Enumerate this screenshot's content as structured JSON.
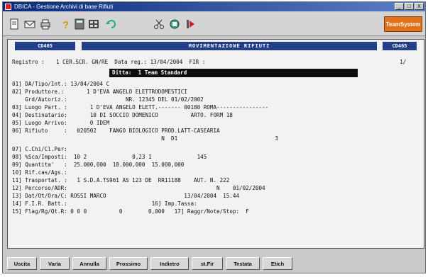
{
  "titlebar": {
    "title": "DBICA - Gestione Archivi di base Rifiuti",
    "min": "_",
    "max": "□",
    "close": "X"
  },
  "toolbar": {
    "brand": "TeamSystem",
    "icons": [
      "doc-icon",
      "mail-icon",
      "print-icon",
      "help-icon",
      "calc-icon",
      "grid-icon",
      "undo-icon",
      "scissors-icon",
      "network-icon",
      "run-icon"
    ]
  },
  "header": {
    "left": "CD465",
    "title": "MOVIMENTAZIONE RIFIUTI",
    "right": "CD465"
  },
  "registro": {
    "label": "Registro :",
    "value": "1 CER.SCR. GN/RE  Data reg.: 13/04/2004  FIR :",
    "page": "1/"
  },
  "ditta": "Ditta:  1 Team Standard",
  "lines": [
    {
      "text": "01] DA/Tipo/Int.: 13/04/2004 C"
    },
    {
      "text": "02] Produttore.:       1 D'EVA ANGELO ELETTRODOMESTICI"
    },
    {
      "text": "    Grd/Autoriz.:                  NR. 12345 DEL 01/02/2002"
    },
    {
      "text": "03] Luogo Part. :       1 D'EVA ANGELO ELETT.------- 00180 ROMA----------------"
    },
    {
      "text": "04] Destinatario:       10 DI SOCCIO DOMENICO          ARTO. FORM 18"
    },
    {
      "text": "05] Luogo Arrivo:       0 IDEM"
    },
    {
      "text": "06] Rifiuto     :   020502    FANGO BIOLOGICO PROD.LATT-CASEARIA"
    },
    {
      "text": "                                              N  D1                              3"
    },
    {
      "text": "07] C.Chi/Cl.Per:"
    },
    {
      "text": "08] %Sca/Imposti:  10 2              0,23 1              145"
    },
    {
      "text": "09] Quantita'   :  25.000,000  18.000,000  15.000,000"
    },
    {
      "text": "10] Rif.cas/Ags.:"
    },
    {
      "text": "11] Trasportat. :   1 S.D.A.TS961 AS 123 DE  RR11188    AUT. N. 222"
    },
    {
      "text": "12] Percorso/ADR:                                              N    01/02/2004"
    },
    {
      "text": "13] Dat/Ot/Ora/C: ROSSI MARCO                        13/04/2004  15.44"
    },
    {
      "text": "14] F.I.R. Batt.:                          16] Imp.Tassa:"
    },
    {
      "text": "15] Flag/Rg/Qt.R: 0 0 0          0        0,000   17] Raggr/Note/Stop:  F"
    }
  ],
  "buttons": [
    {
      "label": "Uscita",
      "name": "uscita-button",
      "width": 42
    },
    {
      "label": "Varia",
      "name": "varia-button",
      "width": 42
    },
    {
      "label": "Annulla",
      "name": "annulla-button",
      "width": 48
    },
    {
      "label": "Prossimo",
      "name": "prossimo-button",
      "width": 54
    },
    {
      "label": "Indietro",
      "name": "indietro-button",
      "width": 54
    },
    {
      "label": "st.Fir",
      "name": "st-fir-button",
      "width": 44
    },
    {
      "label": "Testata",
      "name": "testata-button",
      "width": 48
    },
    {
      "label": "Etich",
      "name": "etich-button",
      "width": 42
    }
  ]
}
